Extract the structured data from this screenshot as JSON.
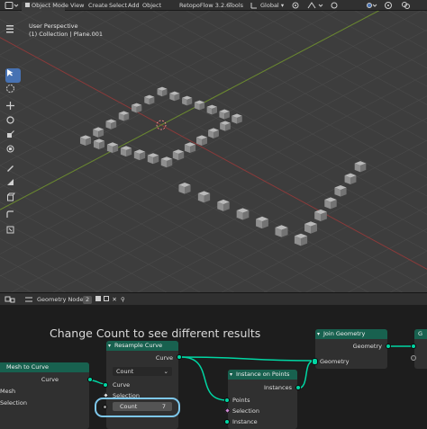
{
  "header": {
    "mode": "Object Mode",
    "menus": [
      "View",
      "Create",
      "Select",
      "Add",
      "Object"
    ],
    "addon": "RetopoFlow 3.2.6",
    "tools_menu": "Tools",
    "orientation": "Global"
  },
  "viewport": {
    "perspective": "User Perspective",
    "collection": "(1) Collection | Plane.001"
  },
  "node_editor_header": {
    "editor_name": "Geometry Nodes",
    "user_count": "2"
  },
  "node_editor": {
    "frame_label": "Change Count to see different results",
    "nodes": {
      "mesh_to_curve": {
        "title": "Mesh to Curve",
        "output": "Curve",
        "input_mesh": "Mesh",
        "input_selection": "Selection"
      },
      "resample_curve": {
        "title": "Resample Curve",
        "output": "Curve",
        "mode": "Count",
        "input_curve": "Curve",
        "input_selection": "Selection",
        "count_label": "Count",
        "count_value": "7"
      },
      "instance_on_points": {
        "title": "Instance on Points",
        "output": "Instances",
        "input_points": "Points",
        "input_selection": "Selection",
        "input_instance": "Instance"
      },
      "join_geometry": {
        "title": "Join Geometry",
        "output": "Geometry",
        "input": "Geometry"
      },
      "group_output": {
        "title": "G"
      }
    }
  },
  "colors": {
    "geometry_socket": "#00d6a3",
    "node_header": "#18614f",
    "active_tool": "#4772b3",
    "highlight_outline": "#7ec8ec"
  }
}
